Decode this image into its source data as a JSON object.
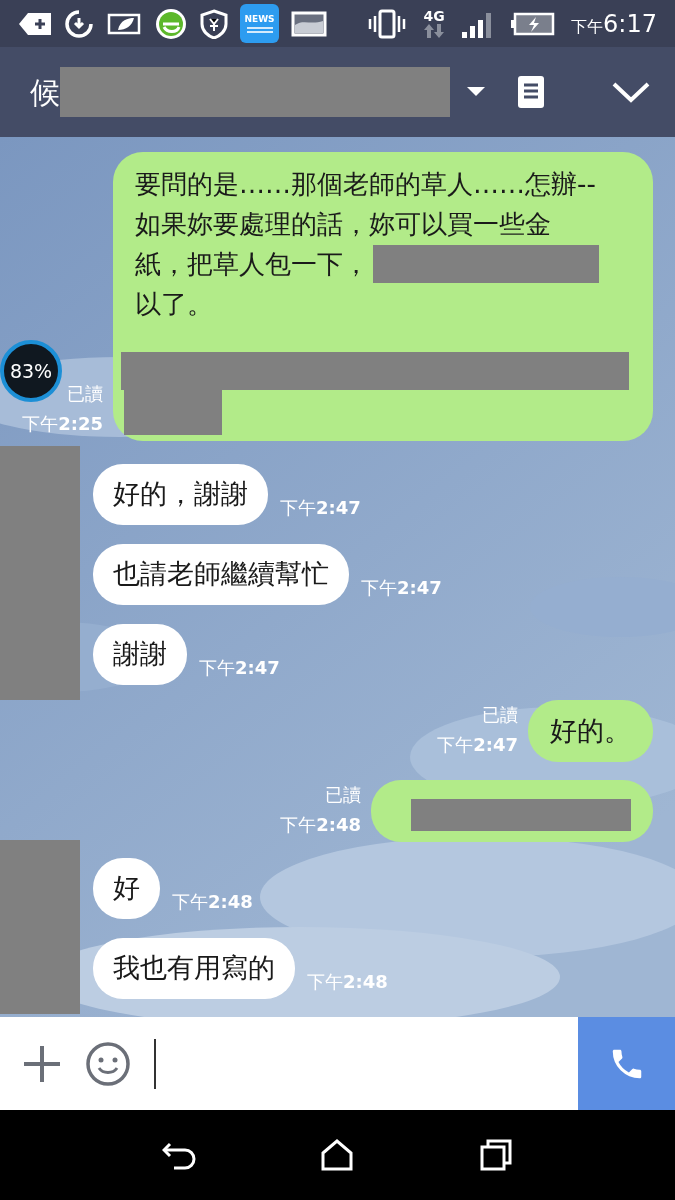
{
  "status_bar": {
    "news_label": "NEWS",
    "network": "4G",
    "time_period": "下午",
    "time": "6:17"
  },
  "header": {
    "title": "候"
  },
  "overlay_badge": "83%",
  "chat": [
    {
      "kind": "outgoing",
      "read": "已讀",
      "time": "下午**2:25**",
      "parts": [
        {
          "kind": "text",
          "text": "要問的是……那個老師的草人……怎辦--"
        },
        {
          "kind": "text",
          "text": "如果妳要處理的話，妳可以買一些金"
        },
        {
          "kind": "text_then_redaction",
          "text": "紙，把草人包一下，"
        },
        {
          "kind": "text",
          "text": "以了。"
        },
        {
          "kind": "gap"
        },
        {
          "kind": "redaction_full"
        },
        {
          "kind": "redaction_short"
        }
      ]
    },
    {
      "kind": "incoming",
      "messages": [
        {
          "text": "好的，謝謝",
          "time": "下午**2:47**"
        },
        {
          "text": "也請老師繼續幫忙",
          "time": "下午**2:47**"
        },
        {
          "text": "謝謝",
          "time": "下午**2:47**"
        }
      ]
    },
    {
      "kind": "outgoing",
      "read": "已讀",
      "time": "下午**2:47**",
      "parts": [
        {
          "kind": "text",
          "text": "好的。"
        }
      ]
    },
    {
      "kind": "outgoing",
      "read": "已讀",
      "time": "下午**2:48**",
      "parts": [
        {
          "kind": "redaction_line"
        }
      ]
    },
    {
      "kind": "incoming",
      "messages": [
        {
          "text": "好",
          "time": "下午**2:48**"
        },
        {
          "text": "我也有用寫的",
          "time": "下午**2:48**"
        }
      ]
    }
  ]
}
